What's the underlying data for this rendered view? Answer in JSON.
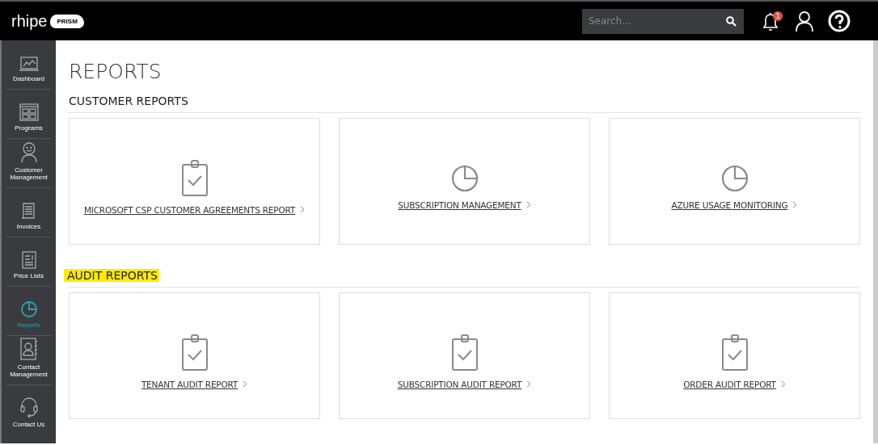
{
  "header": {
    "logo": "rhipe",
    "logo_badge": "PRISM",
    "search": {
      "placeholder": "Search..."
    },
    "notifications": {
      "count": "1"
    }
  },
  "sidebar": {
    "items": [
      {
        "label": "Dashboard",
        "kind": "dashboard",
        "selected": false
      },
      {
        "label": "Programs",
        "kind": "programs",
        "selected": false
      },
      {
        "label": "Customer Management",
        "kind": "customer",
        "selected": false
      },
      {
        "label": "Invoices",
        "kind": "invoices",
        "selected": false
      },
      {
        "label": "Price Lists",
        "kind": "pricelists",
        "selected": false
      },
      {
        "label": "Reports",
        "kind": "reports",
        "selected": true
      },
      {
        "label": "Contact Management",
        "kind": "contacts",
        "selected": false
      },
      {
        "label": "Contact Us",
        "kind": "support",
        "selected": false
      }
    ]
  },
  "page": {
    "title": "REPORTS",
    "sections": [
      {
        "title": "CUSTOMER REPORTS",
        "highlighted": false,
        "cards": [
          {
            "label": "MICROSOFT CSP CUSTOMER AGREEMENTS REPORT",
            "kind": "clipboard"
          },
          {
            "label": "SUBSCRIPTION MANAGEMENT",
            "kind": "pie"
          },
          {
            "label": "AZURE USAGE MONITORING",
            "kind": "pie"
          }
        ]
      },
      {
        "title": "AUDIT REPORTS",
        "highlighted": true,
        "cards": [
          {
            "label": "TENANT AUDIT REPORT",
            "kind": "clipboard"
          },
          {
            "label": "SUBSCRIPTION AUDIT REPORT",
            "kind": "clipboard"
          },
          {
            "label": "ORDER AUDIT REPORT",
            "kind": "clipboard"
          }
        ]
      }
    ]
  }
}
